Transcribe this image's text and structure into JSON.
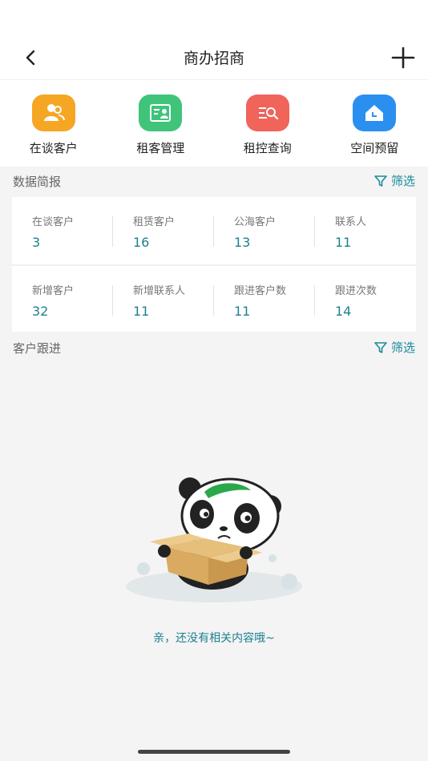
{
  "header": {
    "title": "商办招商"
  },
  "quick_actions": [
    {
      "label": "在谈客户",
      "icon": "people-icon",
      "color": "#f5a623"
    },
    {
      "label": "租客管理",
      "icon": "tenant-card-icon",
      "color": "#3fc47a"
    },
    {
      "label": "租控查询",
      "icon": "list-search-icon",
      "color": "#f0645a"
    },
    {
      "label": "空间预留",
      "icon": "home-clock-icon",
      "color": "#2b8ff0"
    }
  ],
  "data_report": {
    "title": "数据简报",
    "filter_label": "筛选",
    "row1": [
      {
        "label": "在谈客户",
        "value": "3"
      },
      {
        "label": "租赁客户",
        "value": "16"
      },
      {
        "label": "公海客户",
        "value": "13"
      },
      {
        "label": "联系人",
        "value": "11"
      }
    ],
    "row2": [
      {
        "label": "新增客户",
        "value": "32"
      },
      {
        "label": "新增联系人",
        "value": "11"
      },
      {
        "label": "跟进客户数",
        "value": "11"
      },
      {
        "label": "跟进次数",
        "value": "14"
      }
    ]
  },
  "followup": {
    "title": "客户跟进",
    "filter_label": "筛选",
    "empty_text": "亲，还没有相关内容哦~"
  },
  "colors": {
    "accent": "#1a8a9a",
    "value": "#1f7f8f"
  }
}
